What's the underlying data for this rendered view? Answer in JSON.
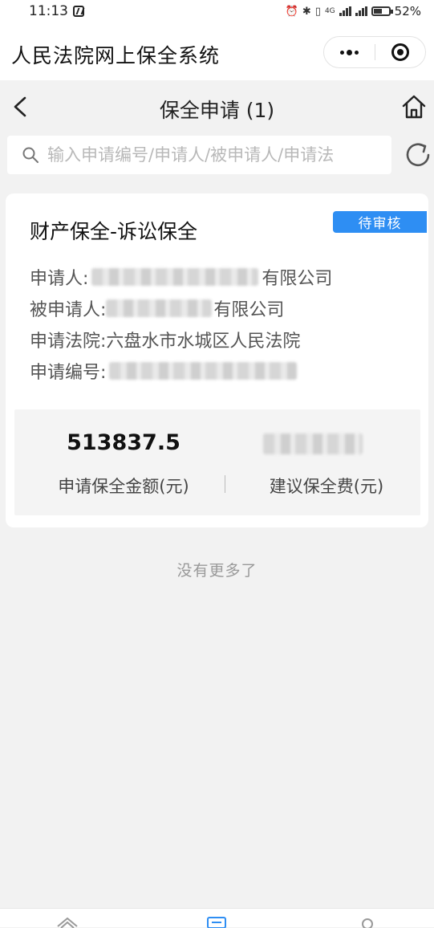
{
  "status_bar": {
    "time": "11:13",
    "network_label": "4G",
    "battery": "52%"
  },
  "app": {
    "title": "人民法院网上保全系统"
  },
  "page": {
    "title": "保全申请 (1)"
  },
  "search": {
    "placeholder": "输入申请编号/申请人/被申请人/申请法"
  },
  "card": {
    "title": "财产保全-诉讼保全",
    "status": "待审核",
    "applicant_label": "申请人:",
    "applicant_suffix": "有限公司",
    "respondent_label": "被申请人:",
    "respondent_suffix": "有限公司",
    "court_label": "申请法院:",
    "court_value": "六盘水市水城区人民法院",
    "number_label": "申请编号:",
    "amount_value": "513837.5",
    "amount_label": "申请保全金额(元)",
    "fee_label": "建议保全费(元)"
  },
  "footer_text": "没有更多了",
  "colors": {
    "badge": "#2e8ef3",
    "background": "#f2f2f2"
  },
  "icons": [
    "back-icon",
    "home-icon",
    "search-icon",
    "refresh-icon",
    "more-icon",
    "target-icon"
  ]
}
